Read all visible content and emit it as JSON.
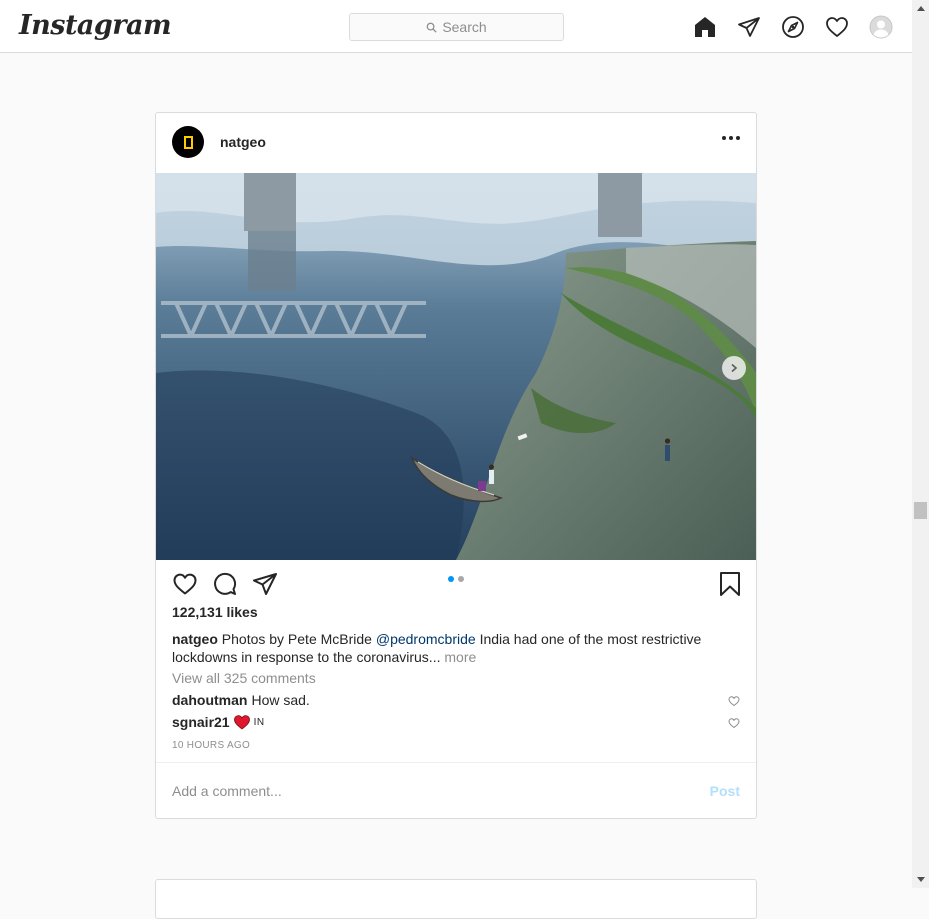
{
  "app": {
    "logo_text": "Instagram"
  },
  "search": {
    "placeholder": "Search",
    "icon": "search-icon"
  },
  "nav": {
    "icons": [
      "home-icon",
      "direct-icon",
      "explore-icon",
      "activity-heart-icon",
      "profile-avatar-icon"
    ]
  },
  "post": {
    "username": "natgeo",
    "avatar_icon": "natgeo-logo",
    "likes": "122,131 likes",
    "caption": {
      "user": "natgeo",
      "text_before": "Photos by Pete McBride",
      "mention": "@pedromcbride",
      "text_after": "India had one of the most restrictive lockdowns in response to the coronavirus...",
      "more": "more"
    },
    "view_all": "View all 325 comments",
    "comments": [
      {
        "user": "dahoutman",
        "text": "How sad."
      },
      {
        "user": "sgnair21",
        "text": "IN",
        "emoji": "red-heart"
      }
    ],
    "timestamp": "10 HOURS AGO",
    "add_comment_placeholder": "Add a comment...",
    "post_button": "Post",
    "carousel": {
      "current": 1,
      "total": 2
    }
  },
  "colors": {
    "accent": "#0095f6",
    "border": "#dbdbdb",
    "background": "#fafafa",
    "mention": "#00376b",
    "post_disabled": "#b2dffc"
  }
}
